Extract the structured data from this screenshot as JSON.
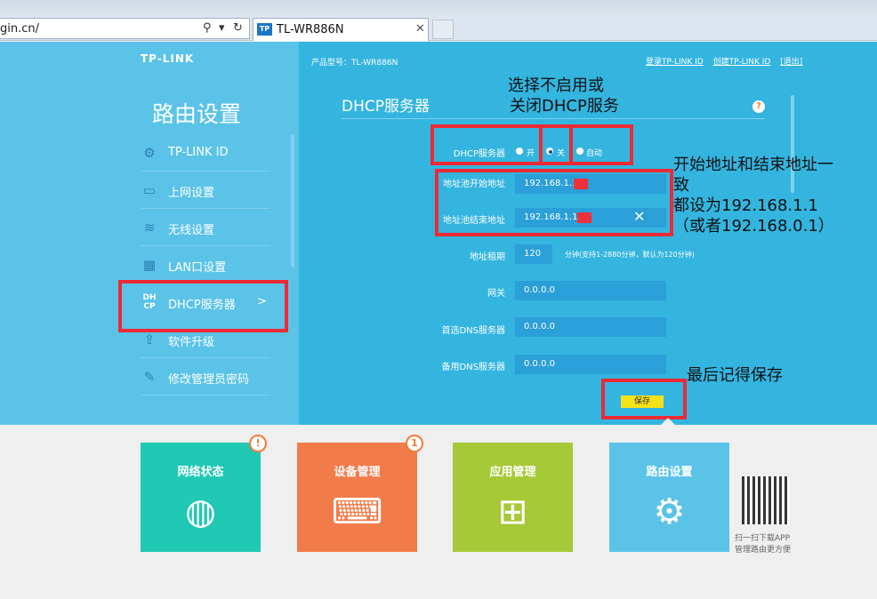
{
  "browser": {
    "address_text": "gin.cn/",
    "address_icons": [
      "search-icon",
      "dropdown-icon",
      "refresh-icon"
    ],
    "tab_logo": "TP",
    "tab_title": "TL-WR886N",
    "tab_close": "✕"
  },
  "sidebar": {
    "logo": "TP-LINK",
    "title": "路由设置",
    "items": [
      {
        "label": "TP-LINK ID",
        "icon": "gear-icon"
      },
      {
        "label": "上网设置",
        "icon": "laptop-icon"
      },
      {
        "label": "无线设置",
        "icon": "wifi-icon"
      },
      {
        "label": "LAN口设置",
        "icon": "lan-icon"
      },
      {
        "label": "DHCP服务器",
        "icon": "dhcp-icon",
        "chevron": ">"
      },
      {
        "label": "软件升级",
        "icon": "upgrade-icon"
      },
      {
        "label": "修改管理员密码",
        "icon": "pencil-icon"
      }
    ]
  },
  "main": {
    "model": "产品型号：TL-WR886N",
    "links": [
      "登录TP-LINK ID",
      "创建TP-LINK ID",
      "[退出]"
    ],
    "section_title": "DHCP服务器",
    "help": "?",
    "dhcp_label": "DHCP服务器",
    "dhcp_options": [
      "开",
      "关",
      "自动"
    ],
    "dhcp_selected": "关",
    "fields": [
      {
        "label": "地址池开始地址",
        "value": "192.168.1.1"
      },
      {
        "label": "地址池结束地址",
        "value": "192.168.1.1"
      },
      {
        "label": "地址租期",
        "value": "120",
        "hint": "分钟(支持1-2880分钟，默认为120分钟)"
      },
      {
        "label": "网关",
        "value": "0.0.0.0"
      },
      {
        "label": "首选DNS服务器",
        "value": "0.0.0.0"
      },
      {
        "label": "备用DNS服务器",
        "value": "0.0.0.0"
      }
    ],
    "save_label": "保存"
  },
  "annotations": {
    "note1": [
      "选择不启用或",
      "关闭DHCP服务"
    ],
    "note2": [
      "开始地址和结束地址一",
      "致",
      "都设为192.168.1.1",
      "（或者192.168.0.1）"
    ],
    "note3": "最后记得保存",
    "color": "#ee2a35"
  },
  "tiles": [
    {
      "label": "网络状态",
      "color": "#1fc9b3",
      "icon": "globe-icon",
      "badge": "!"
    },
    {
      "label": "设备管理",
      "color": "#f27b4a",
      "icon": "laptop-icon",
      "badge": "1"
    },
    {
      "label": "应用管理",
      "color": "#a6c937",
      "icon": "apps-icon"
    },
    {
      "label": "路由设置",
      "color": "#5bc3e8",
      "icon": "router-settings-icon"
    }
  ],
  "qr_text": [
    "扫一扫下载APP",
    "管理路由更方便"
  ]
}
